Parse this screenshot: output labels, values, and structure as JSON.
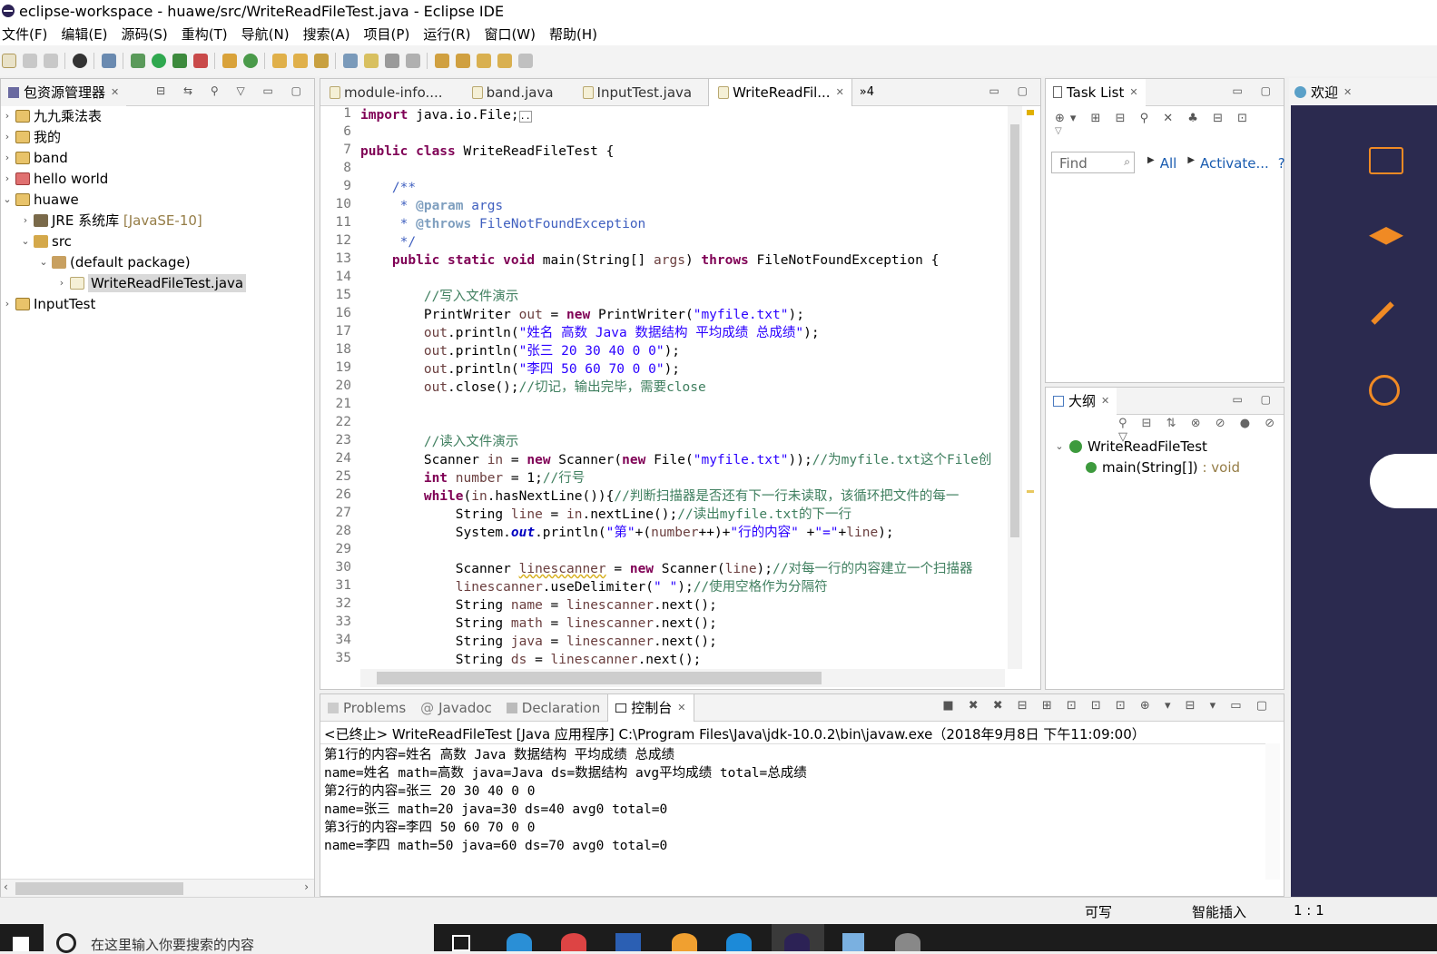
{
  "window": {
    "title": "eclipse-workspace - huawe/src/WriteReadFileTest.java - Eclipse IDE"
  },
  "menu": [
    "文件(F)",
    "编辑(E)",
    "源码(S)",
    "重构(T)",
    "导航(N)",
    "搜索(A)",
    "项目(P)",
    "运行(R)",
    "窗口(W)",
    "帮助(H)"
  ],
  "explorer": {
    "title": "包资源管理器",
    "items": [
      {
        "label": "九九乘法表",
        "expanded": false
      },
      {
        "label": "我的",
        "expanded": false
      },
      {
        "label": "band",
        "expanded": false
      },
      {
        "label": "hello world",
        "expanded": false
      },
      {
        "label": "huawe",
        "expanded": true
      },
      {
        "label": "JRE 系统库",
        "suffix": "[JavaSE-10]"
      },
      {
        "label": "src"
      },
      {
        "label": "(default package)"
      },
      {
        "label": "WriteReadFileTest.java"
      },
      {
        "label": "InputTest",
        "expanded": false
      }
    ]
  },
  "editor": {
    "tabs": [
      "module-info....",
      "band.java",
      "InputTest.java",
      "WriteReadFil..."
    ],
    "overflow": "»4",
    "line_numbers": [
      "1",
      "6",
      "7",
      "8",
      "9",
      "10",
      "11",
      "12",
      "13",
      "14",
      "15",
      "16",
      "17",
      "18",
      "19",
      "20",
      "21",
      "22",
      "23",
      "24",
      "25",
      "26",
      "27",
      "28",
      "29",
      "30",
      "31",
      "32",
      "33",
      "34",
      "35"
    ]
  },
  "tasklist": {
    "title": "Task List",
    "find_placeholder": "Find",
    "all": "All",
    "activate": "Activate..."
  },
  "outline": {
    "title": "大纲",
    "class": "WriteReadFileTest",
    "method": "main(String[])",
    "return": ": void"
  },
  "welcome": {
    "title": "欢迎"
  },
  "bottom": {
    "tabs": [
      "Problems",
      "Javadoc",
      "Declaration",
      "控制台"
    ],
    "header": "<已终止> WriteReadFileTest [Java 应用程序] C:\\Program Files\\Java\\jdk-10.0.2\\bin\\javaw.exe（2018年9月8日 下午11:09:00）",
    "output": [
      "第1行的内容=姓名 高数 Java 数据结构 平均成绩 总成绩",
      "name=姓名 math=高数 java=Java ds=数据结构 avg平均成绩 total=总成绩",
      "第2行的内容=张三 20 30 40 0 0",
      "name=张三 math=20 java=30 ds=40 avg0 total=0",
      "第3行的内容=李四 50 60 70 0 0",
      "name=李四 math=50 java=60 ds=70 avg0 total=0"
    ]
  },
  "status": {
    "writable": "可写",
    "insert": "智能插入",
    "position": "1 : 1"
  },
  "taskbar": {
    "search_placeholder": "在这里输入你要搜索的内容"
  }
}
